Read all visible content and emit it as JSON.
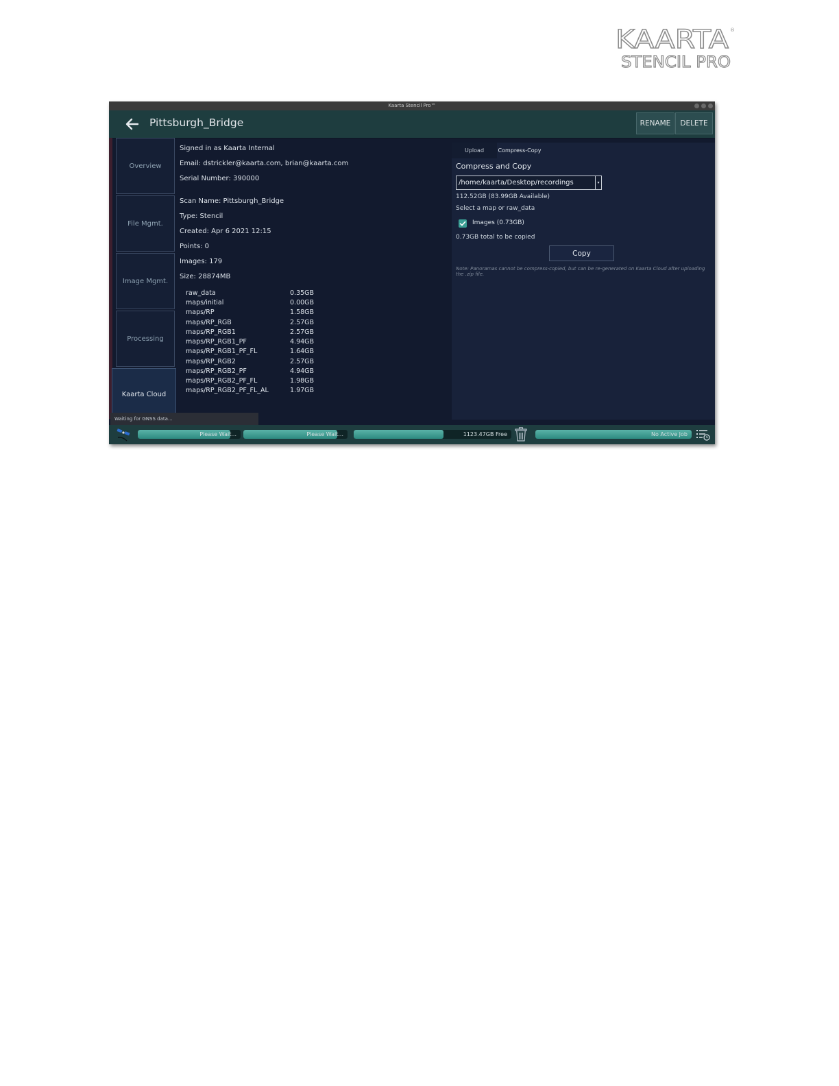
{
  "logo": {
    "line1": "KAARTA",
    "line2": "STENCIL PRO",
    "registered": "®"
  },
  "window": {
    "title": "Kaarta Stencil Pro™"
  },
  "header": {
    "scan_title": "Pittsburgh_Bridge",
    "rename_label": "RENAME",
    "delete_label": "DELETE"
  },
  "sidebar": {
    "items": [
      {
        "label": "Overview"
      },
      {
        "label": "File Mgmt."
      },
      {
        "label": "Image Mgmt."
      },
      {
        "label": "Processing"
      },
      {
        "label": "Kaarta Cloud"
      }
    ]
  },
  "account": {
    "signed_in": "Signed in as Kaarta Internal",
    "email": "Email: dstrickler@kaarta.com, brian@kaarta.com",
    "serial": "Serial Number: 390000"
  },
  "scan": {
    "name": "Scan Name: Pittsburgh_Bridge",
    "type": "Type: Stencil",
    "created": "Created: Apr 6 2021 12:15",
    "points": "Points: 0",
    "images": "Images: 179",
    "size": "Size: 28874MB"
  },
  "sizes": [
    {
      "name": "raw_data",
      "value": "0.35GB"
    },
    {
      "name": "maps/initial",
      "value": "0.00GB"
    },
    {
      "name": "maps/RP",
      "value": "1.58GB"
    },
    {
      "name": "maps/RP_RGB",
      "value": "2.57GB"
    },
    {
      "name": "maps/RP_RGB1",
      "value": "2.57GB"
    },
    {
      "name": "maps/RP_RGB1_PF",
      "value": "4.94GB"
    },
    {
      "name": "maps/RP_RGB1_PF_FL",
      "value": "1.64GB"
    },
    {
      "name": "maps/RP_RGB2",
      "value": "2.57GB"
    },
    {
      "name": "maps/RP_RGB2_PF",
      "value": "4.94GB"
    },
    {
      "name": "maps/RP_RGB2_PF_FL",
      "value": "1.98GB"
    },
    {
      "name": "maps/RP_RGB2_PF_FL_AL",
      "value": "1.97GB"
    }
  ],
  "tabs": {
    "upload": "Upload",
    "compress": "Compress-Copy"
  },
  "compress": {
    "title": "Compress and Copy",
    "path": "/home/kaarta/Desktop/recordings",
    "available": "112.52GB (83.99GB Available)",
    "select_prompt": "Select a map or raw_data",
    "images_option": "Images (0.73GB)",
    "images_checked": true,
    "total": "0.73GB total to be copied",
    "copy_label": "Copy",
    "note": "Note: Panoramas cannot be compress-copied, but can be re-generated on Kaarta Cloud after uploading the .zip file."
  },
  "status": {
    "gnss": "Waiting for GNSS data...",
    "bar1": {
      "label": "Please Wait...",
      "fill": 0.9
    },
    "bar2": {
      "label": "Please Wait...",
      "fill": 0.9
    },
    "bar3": {
      "label": "1123.47GB Free",
      "fill": 0.57
    },
    "bar4": {
      "label": "No Active Job",
      "fill": 1.0
    }
  },
  "colors": {
    "accent": "#3a9e94",
    "header": "#1e3d3f",
    "background": "#121a2e"
  },
  "icons": {
    "back": "back-arrow-icon",
    "satellite": "satellite-icon",
    "trash": "trash-icon",
    "jobs": "job-list-icon"
  }
}
